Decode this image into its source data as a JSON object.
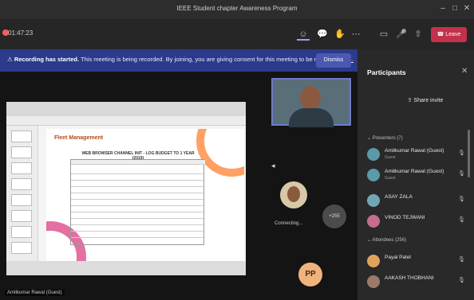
{
  "window": {
    "title": "IEEE Student chapter Awareness Program",
    "min": "–",
    "max": "□",
    "close": "✕"
  },
  "toolbar": {
    "timer": "01:47:23",
    "leave_label": "Leave"
  },
  "banner": {
    "lead": "Recording has started.",
    "text": "This meeting is being recorded. By joining, you are giving consent for this meeting to be recorded.",
    "link": "Pri...",
    "dismiss_label": "Dismiss"
  },
  "share": {
    "slide_title": "Fleet Management",
    "table_title": "WEB BROWSER CHANNEL INIT - LOG BUDGET TO 1 YEAR (2019)"
  },
  "tiles": {
    "photo_label": "Connecting...",
    "more_count": "+255",
    "pp_initials": "PP",
    "presenter_name": "Amitkumar Rawal (Guest)"
  },
  "panel": {
    "title": "Participants",
    "share_invite": "Share invite",
    "section_presenters": "Presenters (7)",
    "section_attendees": "Attendees (256)",
    "participants": [
      {
        "name": "Amitkumar Rawal (Guest)",
        "role": "Guest",
        "mic": "🎙",
        "avatar_color": "#5b9aa8"
      },
      {
        "name": "Amitkumar Rawal (Guest)",
        "role": "Guest",
        "mic": "🎙",
        "avatar_color": "#5b9aa8"
      },
      {
        "name": "ASAY ZALA",
        "role": "",
        "mic": "🎙",
        "avatar_color": "#6fa8b4"
      },
      {
        "name": "VINOD TEJWANI",
        "role": "",
        "mic": "🎙",
        "avatar_color": "#c76b8f"
      }
    ],
    "attendees": [
      {
        "name": "Payal Patel",
        "role": "",
        "mic": "🎙",
        "avatar_color": "#e0a35c"
      },
      {
        "name": "AAKASH THOBHANI",
        "role": "",
        "mic": "🎙",
        "avatar_color": "#9a7b6a"
      }
    ]
  }
}
